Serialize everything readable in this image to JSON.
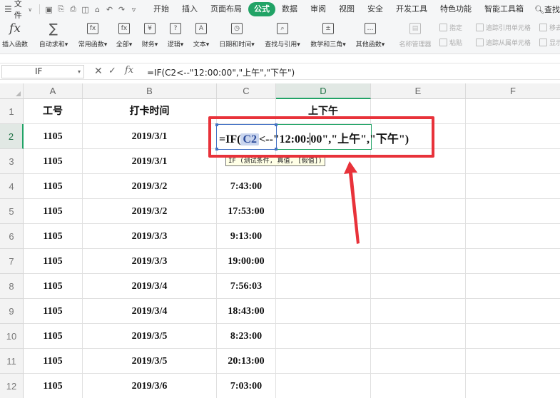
{
  "menubar": {
    "file_label": "文件",
    "tabs": [
      "开始",
      "插入",
      "页面布局",
      "公式",
      "数据",
      "审阅",
      "视图",
      "安全",
      "开发工具",
      "特色功能",
      "智能工具箱"
    ],
    "active_tab": "公式",
    "search_label": "查找"
  },
  "ribbon": {
    "buttons": [
      {
        "label": "插入函数",
        "icon": "fx-icon"
      },
      {
        "label": "自动求和",
        "icon": "sigma-icon"
      },
      {
        "label": "常用函数",
        "icon": "function-icon"
      },
      {
        "label": "全部",
        "icon": "function-icon"
      },
      {
        "label": "财务",
        "icon": "finance-icon"
      },
      {
        "label": "逻辑",
        "icon": "logic-icon"
      },
      {
        "label": "文本",
        "icon": "text-icon"
      },
      {
        "label": "日期和时间",
        "icon": "clock-icon"
      },
      {
        "label": "查找与引用",
        "icon": "lookup-icon"
      },
      {
        "label": "数学和三角",
        "icon": "math-icon"
      },
      {
        "label": "其他函数",
        "icon": "more-functions-icon"
      },
      {
        "label": "名称管理器",
        "icon": "name-manager-icon"
      }
    ],
    "small_buttons": [
      "指定",
      "粘贴",
      "追踪引用单元格",
      "追踪从属单元格",
      "移去",
      "显示"
    ]
  },
  "formula_bar": {
    "name_box": "IF",
    "formula": "=IF(C2<--\"12:00:00\",\"上午\",\"下午\")"
  },
  "grid": {
    "columns": [
      "A",
      "B",
      "C",
      "D",
      "E",
      "F"
    ],
    "selected_column": "D",
    "selected_row": "2",
    "headers": {
      "a": "工号",
      "b": "打卡时间",
      "c": "",
      "d": "上下午"
    },
    "rows": [
      {
        "num": "1"
      },
      {
        "num": "2",
        "a": "1105",
        "b": "2019/3/1",
        "c": ""
      },
      {
        "num": "3",
        "a": "1105",
        "b": "2019/3/1",
        "c": ""
      },
      {
        "num": "4",
        "a": "1105",
        "b": "2019/3/2",
        "c": "7:43:00"
      },
      {
        "num": "5",
        "a": "1105",
        "b": "2019/3/2",
        "c": "17:53:00"
      },
      {
        "num": "6",
        "a": "1105",
        "b": "2019/3/3",
        "c": "9:13:00"
      },
      {
        "num": "7",
        "a": "1105",
        "b": "2019/3/3",
        "c": "19:00:00"
      },
      {
        "num": "8",
        "a": "1105",
        "b": "2019/3/4",
        "c": "7:56:03"
      },
      {
        "num": "9",
        "a": "1105",
        "b": "2019/3/4",
        "c": "18:43:00"
      },
      {
        "num": "10",
        "a": "1105",
        "b": "2019/3/5",
        "c": "8:23:00"
      },
      {
        "num": "11",
        "a": "1105",
        "b": "2019/3/5",
        "c": "20:13:00"
      },
      {
        "num": "12",
        "a": "1105",
        "b": "2019/3/6",
        "c": "7:03:00"
      }
    ]
  },
  "editor": {
    "prefix": "=IF(",
    "ref": "C2",
    "suffix_a": "<--\"12:00:",
    "suffix_b": "00\",\"上午\",\"下午\")",
    "tooltip": "IF (测试条件, 真值, [假值])"
  },
  "colors": {
    "accent": "#21a366",
    "highlight_box": "#e8323a",
    "reference": "#4472c4"
  }
}
